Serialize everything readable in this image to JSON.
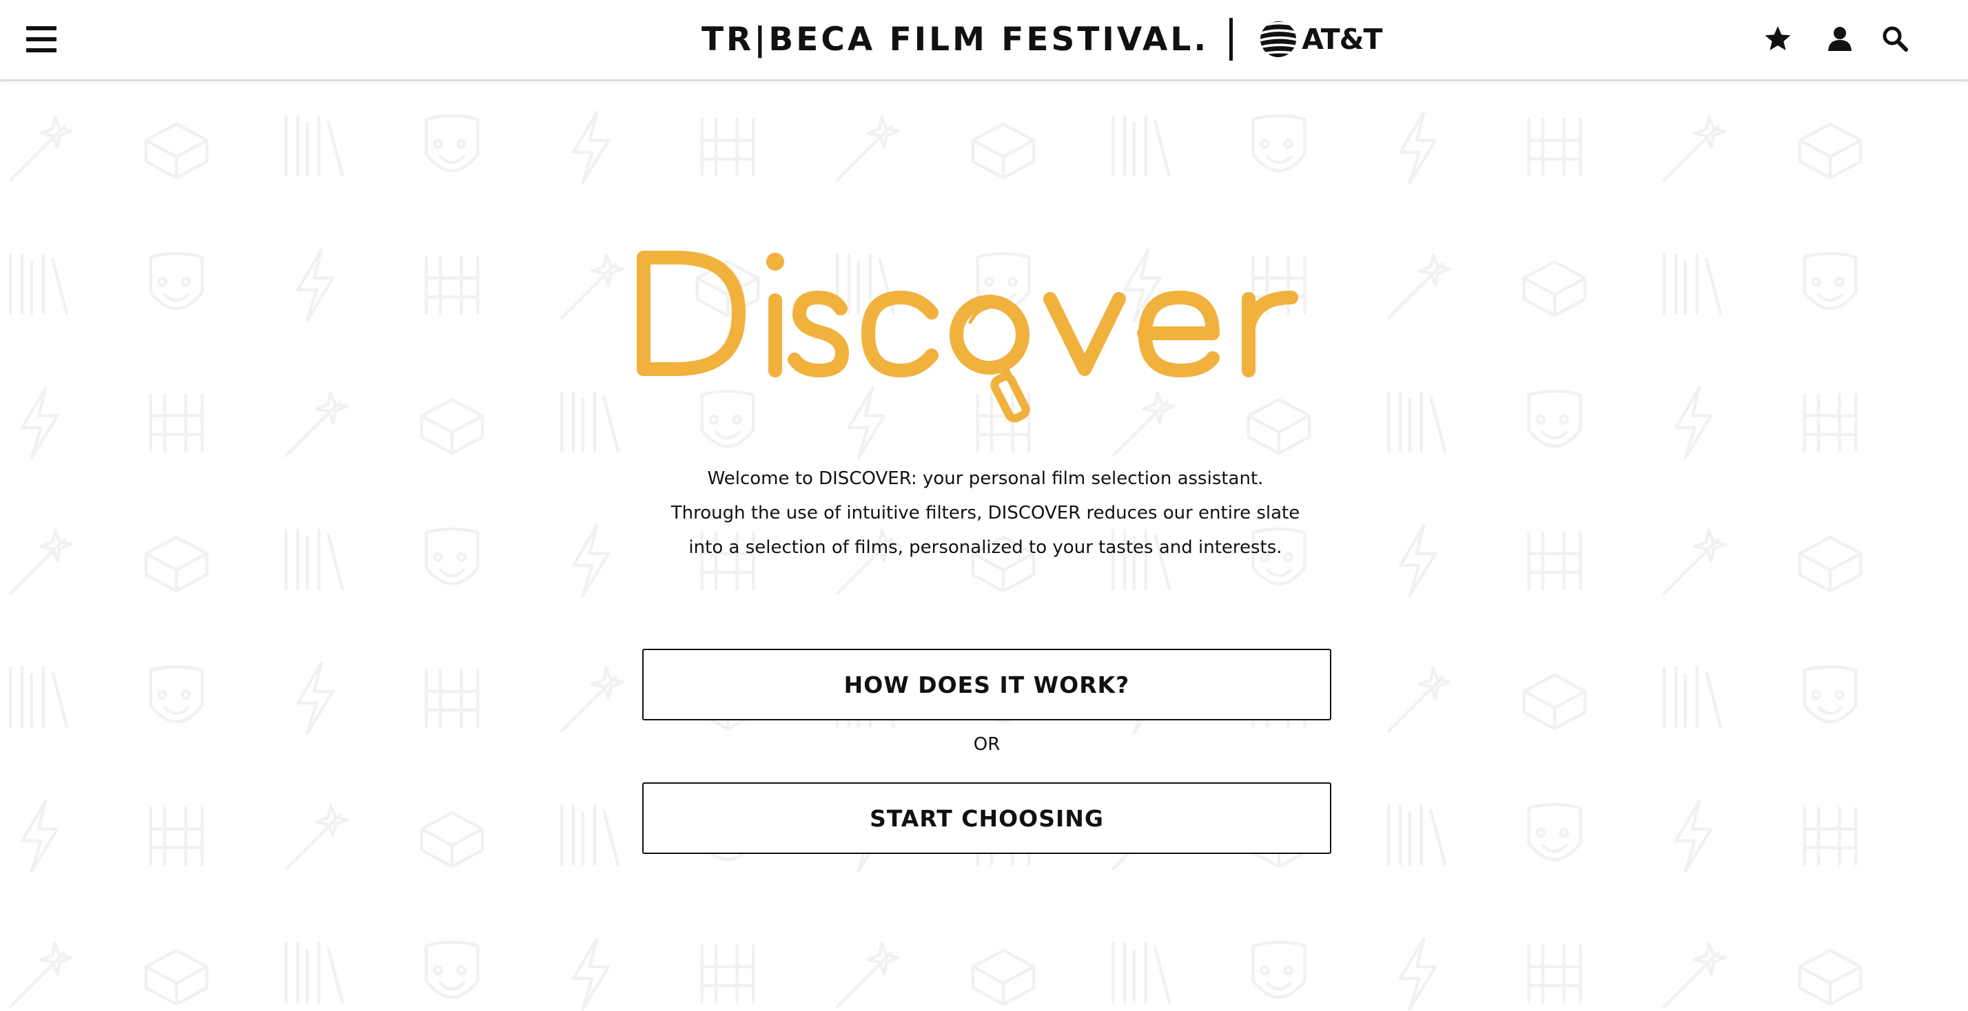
{
  "header": {
    "brand": "TR|BECA FILM FESTIVAL.",
    "sponsor": "AT&T",
    "icons": [
      "menu-icon",
      "star-icon",
      "user-icon",
      "search-icon"
    ]
  },
  "hero": {
    "logo_text": "Discover",
    "intro": [
      "Welcome to DISCOVER: your personal film selection assistant.",
      "Through the use of intuitive filters, DISCOVER reduces our entire slate",
      "into a selection of films, personalized to your tastes and interests."
    ],
    "how_button": "HOW DOES IT WORK?",
    "or_label": "OR",
    "start_button": "START CHOOSING"
  },
  "colors": {
    "accent": "#f0b13d",
    "text": "#111111",
    "pattern": "#f1f1f1",
    "background": "#ffffff"
  }
}
